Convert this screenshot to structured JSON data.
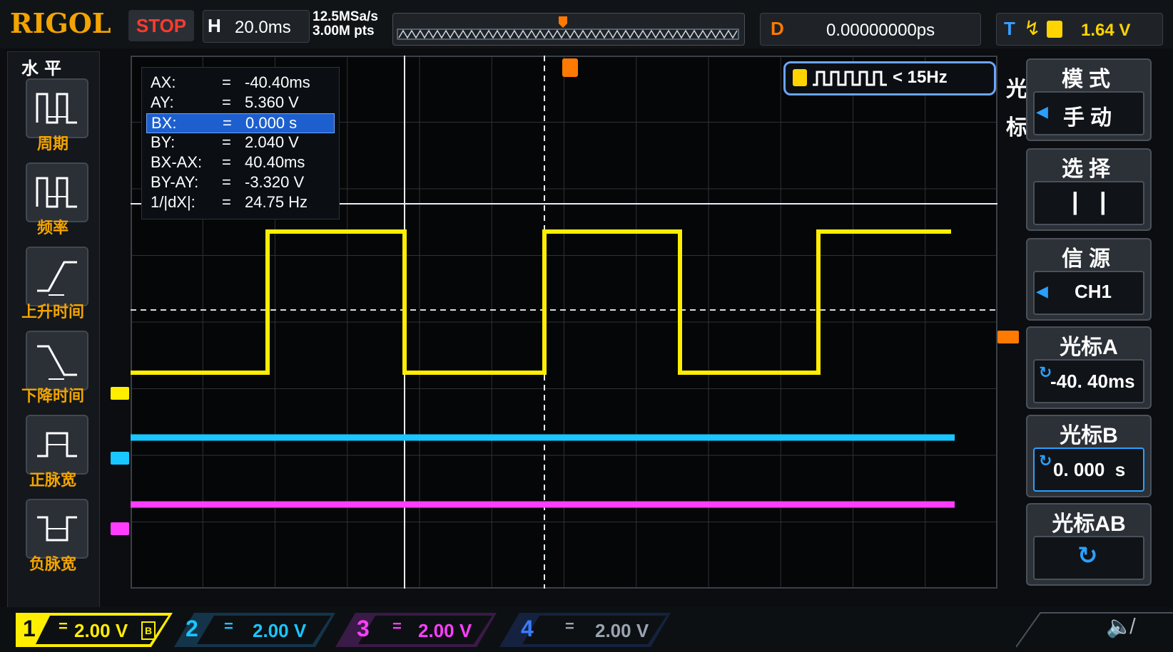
{
  "header": {
    "brand": "RIGOL",
    "run_status": "STOP",
    "horizontal_label": "H",
    "timebase": "20.0ms",
    "sample_rate": "12.5MSa/s",
    "memory_depth": "3.00M pts",
    "delay_label": "D",
    "delay_value": "0.00000000ps",
    "trigger_label": "T",
    "trigger_level": "1.64 V"
  },
  "left_menu": {
    "title": "水平",
    "items": [
      {
        "label": "周期",
        "icon": "period-icon"
      },
      {
        "label": "频率",
        "icon": "frequency-icon"
      },
      {
        "label": "上升时间",
        "icon": "rise-time-icon"
      },
      {
        "label": "下降时间",
        "icon": "fall-time-icon"
      },
      {
        "label": "正脉宽",
        "icon": "positive-width-icon"
      },
      {
        "label": "负脉宽",
        "icon": "negative-width-icon"
      }
    ]
  },
  "measurements": [
    {
      "key": "AX:",
      "value": "-40.40ms"
    },
    {
      "key": "AY:",
      "value": "5.360 V"
    },
    {
      "key": "BX:",
      "value": "0.000 s"
    },
    {
      "key": "BY:",
      "value": "2.040 V"
    },
    {
      "key": "BX-AX:",
      "value": "40.40ms"
    },
    {
      "key": "BY-AY:",
      "value": "-3.320 V"
    },
    {
      "key": "1/|dX|:",
      "value": "24.75 Hz"
    }
  ],
  "freq_counter": {
    "value": "< 15Hz"
  },
  "right_menu": {
    "side_label_1": "光",
    "side_label_2": "标",
    "mode_title": "模式",
    "mode_value": "手动",
    "select_title": "选择",
    "select_value": "| |",
    "source_title": "信源",
    "source_value": "CH1",
    "cursor_a_title": "光标A",
    "cursor_a_value": "-40. 40ms",
    "cursor_b_title": "光标B",
    "cursor_b_value": "0. 000  s",
    "cursor_ab_title": "光标AB"
  },
  "channels": [
    {
      "num": "1",
      "value": "2.00 V",
      "color": "#ffee00"
    },
    {
      "num": "2",
      "value": "2.00 V",
      "color": "#19c6ff"
    },
    {
      "num": "3",
      "value": "2.00 V",
      "color": "#ff3dff"
    },
    {
      "num": "4",
      "value": "2.00 V",
      "color": "#3a7cff"
    }
  ]
}
